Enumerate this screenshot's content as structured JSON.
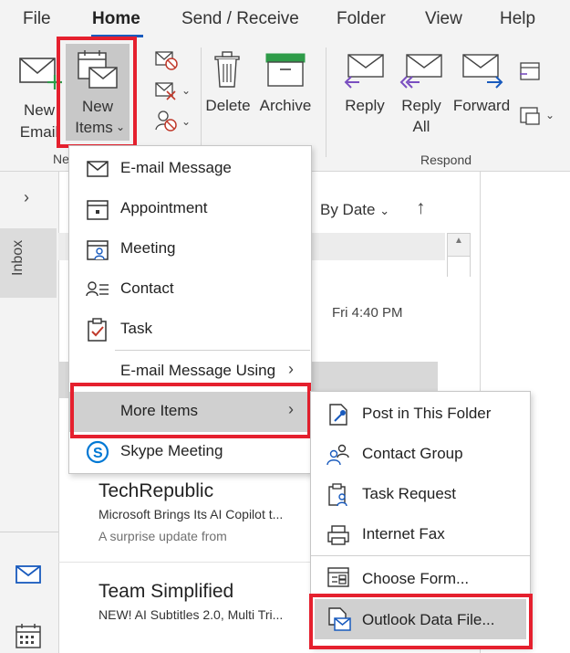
{
  "tabs": [
    "File",
    "Home",
    "Send / Receive",
    "Folder",
    "View",
    "Help"
  ],
  "ribbon": {
    "new_email": [
      "New",
      "Email"
    ],
    "new_items": [
      "New",
      "Items"
    ],
    "delete": "Delete",
    "archive": "Archive",
    "reply": "Reply",
    "reply_all": [
      "Reply",
      "All"
    ],
    "forward": "Forward",
    "group_new_partial": "Ne",
    "group_respond": "Respond"
  },
  "left_rail": {
    "folder_label": "Inbox"
  },
  "list_header": {
    "sort_label": "By Date"
  },
  "messages": [
    {
      "date": "Fri 4:40 PM"
    },
    {
      "sender": "TechRepublic",
      "subject": "Microsoft Brings Its AI Copilot t...",
      "preview": "A surprise update from"
    },
    {
      "sender": "Team Simplified",
      "subject": "NEW! AI Subtitles 2.0, Multi Tri..."
    }
  ],
  "new_items_menu": [
    {
      "label": "E-mail Message",
      "icon": "envelope-icon"
    },
    {
      "label": "Appointment",
      "icon": "calendar-icon"
    },
    {
      "label": "Meeting",
      "icon": "meeting-icon"
    },
    {
      "label": "Contact",
      "icon": "contact-card-icon"
    },
    {
      "label": "Task",
      "icon": "clipboard-check-icon"
    },
    {
      "label": "E-mail Message Using",
      "icon": ""
    },
    {
      "label": "More Items",
      "icon": ""
    },
    {
      "label": "Skype Meeting",
      "icon": "skype-icon"
    }
  ],
  "more_items_submenu": [
    {
      "label": "Post in This Folder",
      "icon": "post-icon"
    },
    {
      "label": "Contact Group",
      "icon": "contact-group-icon"
    },
    {
      "label": "Task Request",
      "icon": "task-request-icon"
    },
    {
      "label": "Internet Fax",
      "icon": "fax-icon"
    },
    {
      "label": "Choose Form...",
      "icon": "form-icon"
    },
    {
      "label": "Outlook Data File...",
      "icon": "data-file-icon"
    }
  ],
  "colors": {
    "accent": "#185abd",
    "highlight_red": "#e5202e",
    "archive_green": "#2e9b48",
    "reply_purple": "#7a4fc0"
  }
}
